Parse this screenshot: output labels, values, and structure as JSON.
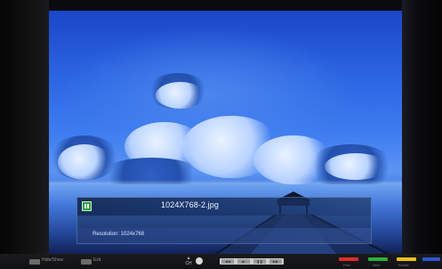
{
  "file": {
    "name": "1024X768-2.jpg",
    "resolution": "Resolution: 1024x768"
  },
  "footer": {
    "hide_show_label": "Hide/Show",
    "exit_label": "Exit",
    "ch_label": "CH",
    "color_keys": [
      {
        "color": "#e22b2b",
        "label": "Prev"
      },
      {
        "color": "#2fae3c",
        "label": "Next"
      },
      {
        "color": "#e8c21a",
        "label": "Rotate"
      },
      {
        "color": "#2e55d6",
        "label": ""
      }
    ]
  },
  "icons": {
    "play_state": "pause-icon",
    "channel": "ch-up-down-icon",
    "ok": "ok-button-icon"
  }
}
